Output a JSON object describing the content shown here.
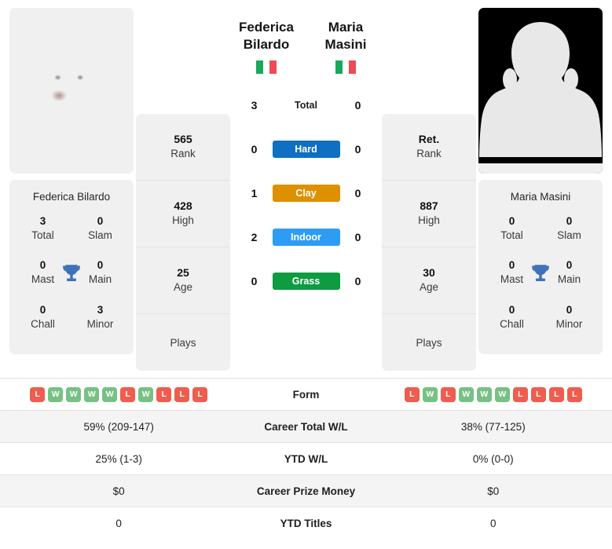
{
  "players": {
    "left": {
      "first_name": "Federica",
      "last_name": "Bilardo",
      "full_name": "Federica Bilardo",
      "country": "Italy",
      "photo_type": "player-photo",
      "rank": "565",
      "rank_label": "Rank",
      "high": "428",
      "high_label": "High",
      "age": "25",
      "age_label": "Age",
      "plays_label": "Plays",
      "plays_value": "",
      "titles": {
        "total": "3",
        "total_label": "Total",
        "slam": "0",
        "slam_label": "Slam",
        "mast": "0",
        "mast_label": "Mast",
        "main": "0",
        "main_label": "Main",
        "chall": "0",
        "chall_label": "Chall",
        "minor": "3",
        "minor_label": "Minor"
      },
      "form": [
        "L",
        "W",
        "W",
        "W",
        "W",
        "L",
        "W",
        "L",
        "L",
        "L"
      ],
      "career_wl": "59% (209-147)",
      "ytd_wl": "25% (1-3)",
      "career_prize": "$0",
      "ytd_titles": "0"
    },
    "right": {
      "first_name": "Maria",
      "last_name": "Masini",
      "full_name": "Maria Masini",
      "country": "Italy",
      "photo_type": "placeholder-avatar",
      "rank": "Ret.",
      "rank_label": "Rank",
      "high": "887",
      "high_label": "High",
      "age": "30",
      "age_label": "Age",
      "plays_label": "Plays",
      "plays_value": "",
      "titles": {
        "total": "0",
        "total_label": "Total",
        "slam": "0",
        "slam_label": "Slam",
        "mast": "0",
        "mast_label": "Mast",
        "main": "0",
        "main_label": "Main",
        "chall": "0",
        "chall_label": "Chall",
        "minor": "0",
        "minor_label": "Minor"
      },
      "form": [
        "L",
        "W",
        "L",
        "W",
        "W",
        "W",
        "L",
        "L",
        "L",
        "L"
      ],
      "career_wl": "38% (77-125)",
      "ytd_wl": "0% (0-0)",
      "career_prize": "$0",
      "ytd_titles": "0"
    }
  },
  "head_to_head": [
    {
      "label": "Total",
      "left": "3",
      "right": "0",
      "color": "",
      "style": "plain"
    },
    {
      "label": "Hard",
      "left": "0",
      "right": "0",
      "color": "#0f6fc0",
      "style": "badge"
    },
    {
      "label": "Clay",
      "left": "1",
      "right": "0",
      "color": "#dd9000",
      "style": "badge"
    },
    {
      "label": "Indoor",
      "left": "2",
      "right": "0",
      "color": "#2f9cf4",
      "style": "badge"
    },
    {
      "label": "Grass",
      "left": "0",
      "right": "0",
      "color": "#0f9b42",
      "style": "badge"
    }
  ],
  "comparison_rows": [
    {
      "label": "Form",
      "type": "form",
      "left": "",
      "right": ""
    },
    {
      "label": "Career Total W/L",
      "type": "text",
      "left": "59% (209-147)",
      "right": "38% (77-125)"
    },
    {
      "label": "YTD W/L",
      "type": "text",
      "left": "25% (1-3)",
      "right": "0% (0-0)"
    },
    {
      "label": "Career Prize Money",
      "type": "text",
      "left": "$0",
      "right": "$0"
    },
    {
      "label": "YTD Titles",
      "type": "text",
      "left": "0",
      "right": "0"
    }
  ],
  "flag_colors": {
    "green": "#1aa85a",
    "white": "#ffffff",
    "red": "#ee4b55"
  },
  "form_colors": {
    "win": "#76c183",
    "loss": "#ef5d4e"
  },
  "trophy_color": "#3f72b8"
}
